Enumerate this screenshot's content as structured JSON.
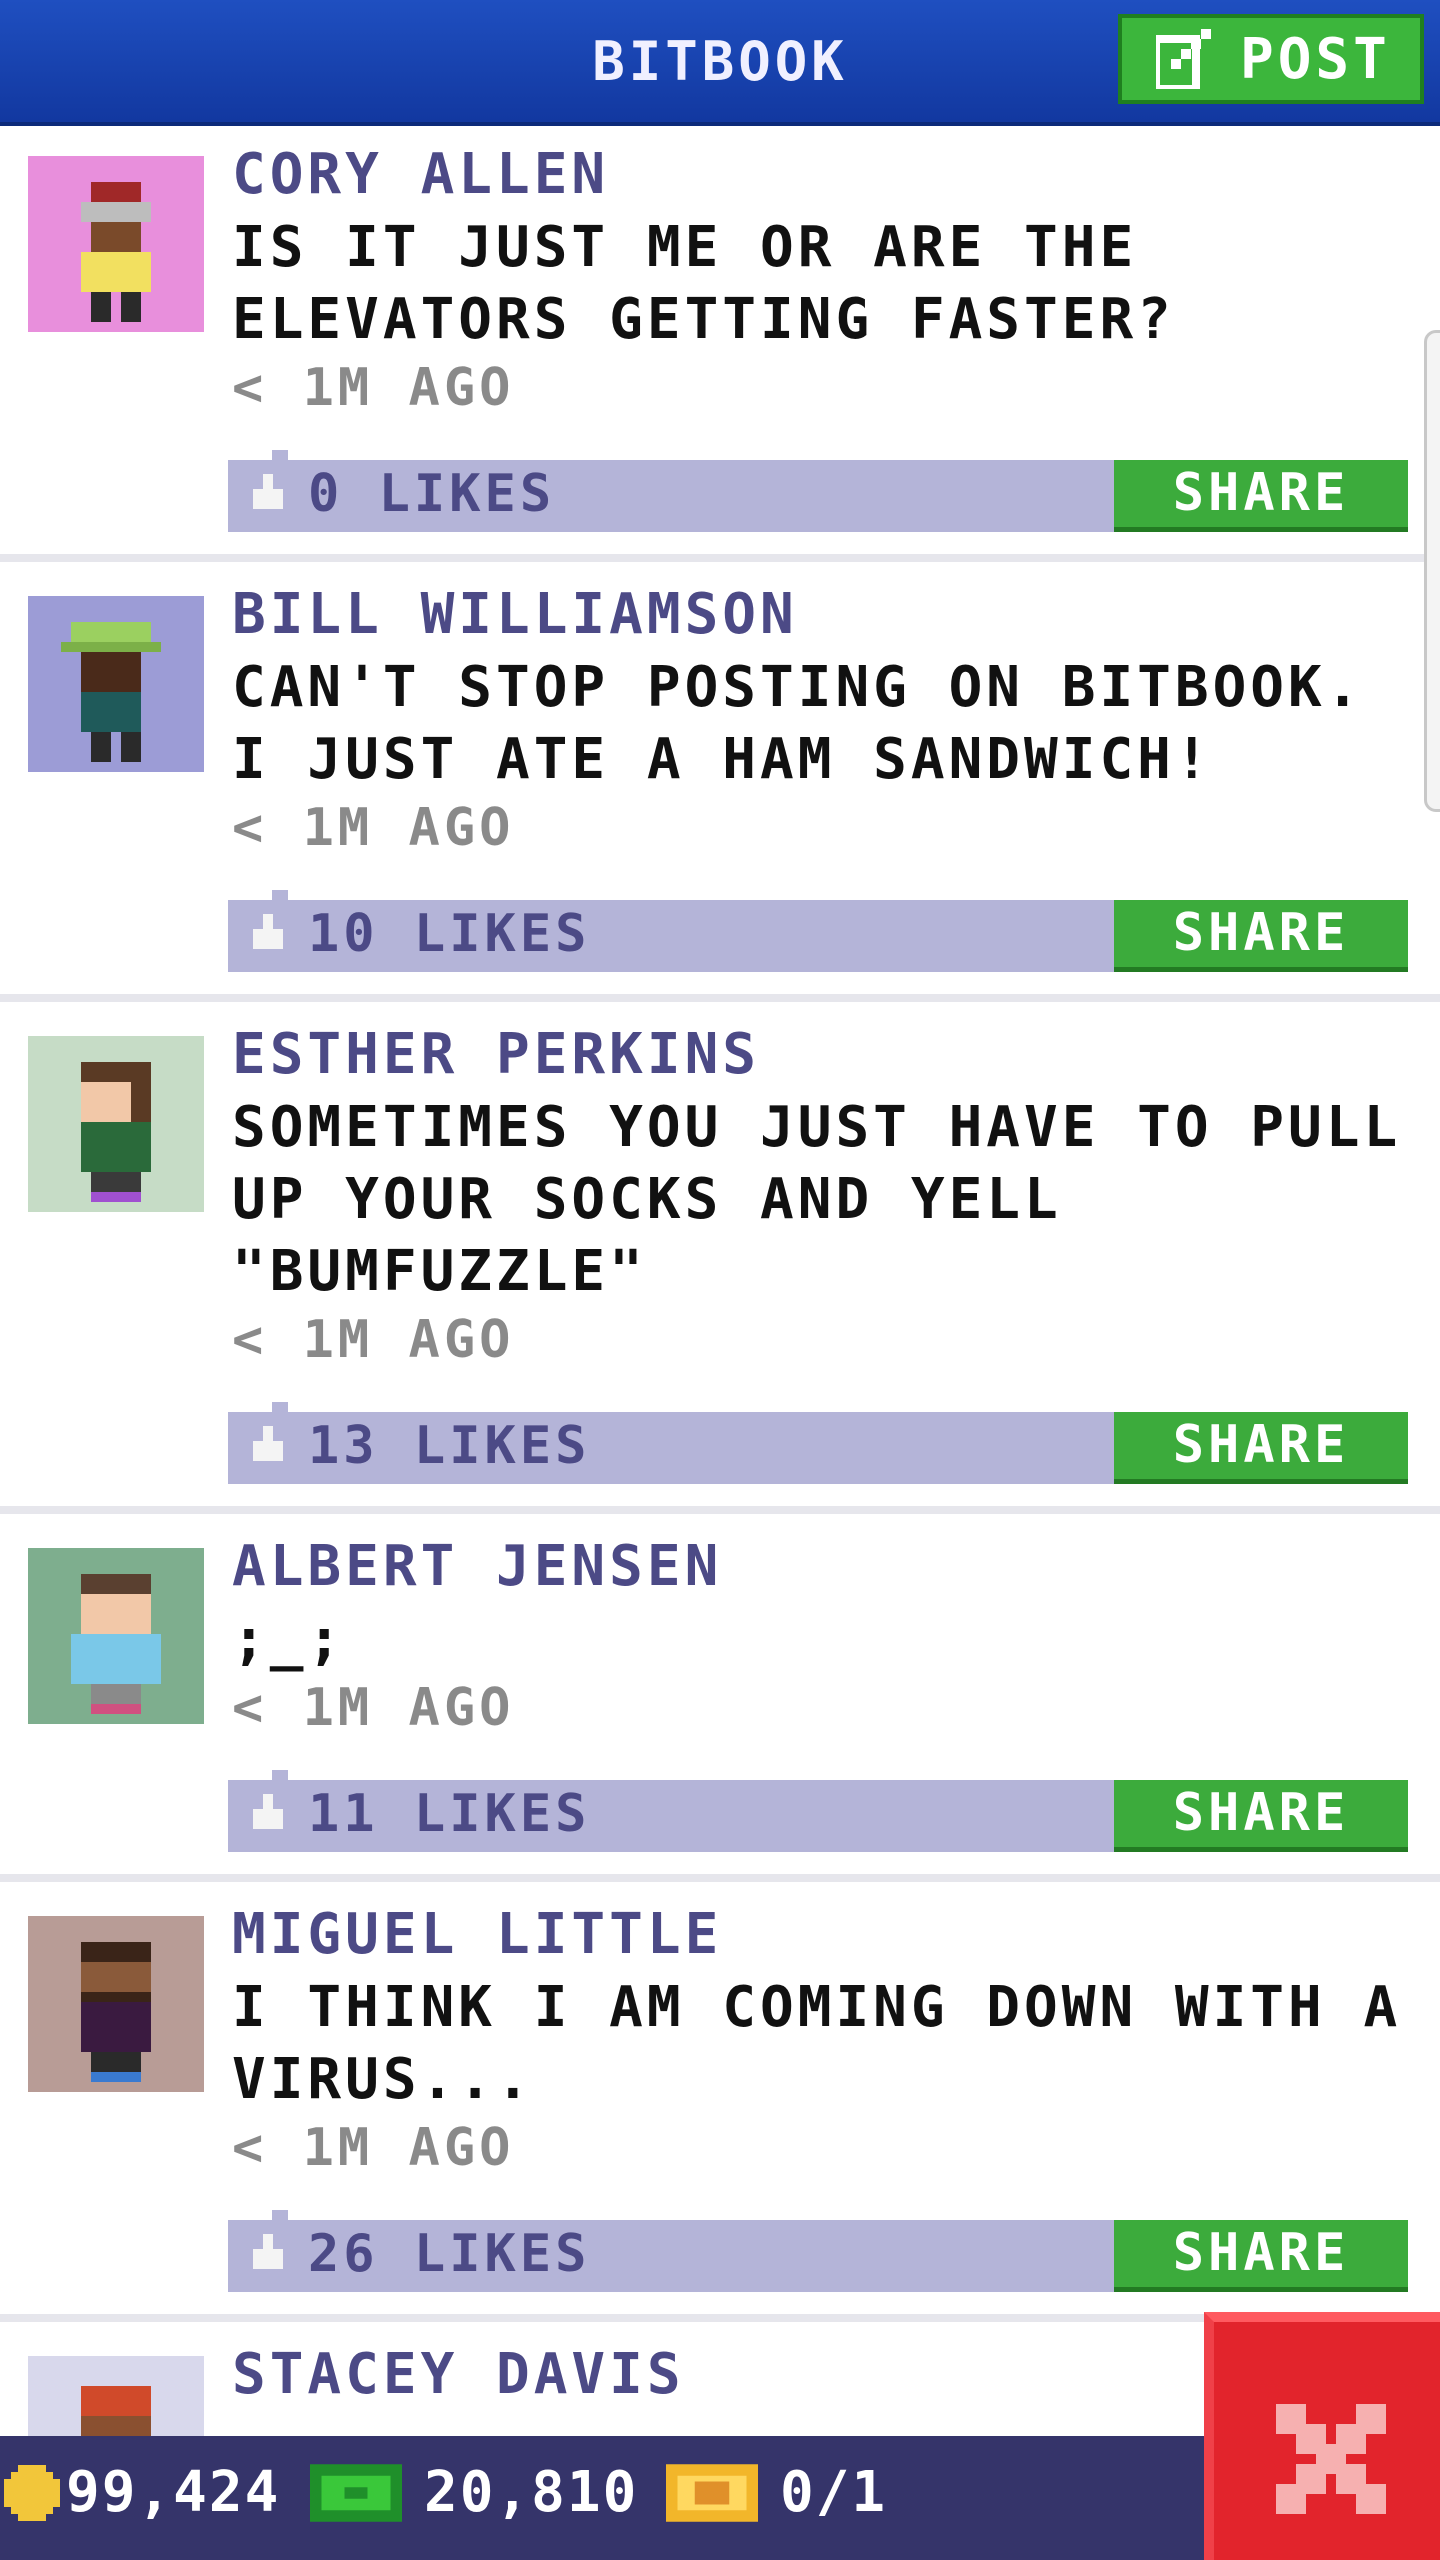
{
  "header": {
    "title": "BITBOOK",
    "post_label": "POST"
  },
  "posts": [
    {
      "author": "CORY ALLEN",
      "text": "IS IT JUST ME OR ARE THE ELEVATORS GETTING FASTER?",
      "time": "< 1M AGO",
      "likes": "0 LIKES",
      "share": "SHARE",
      "avatar_bg": "#e88fdc"
    },
    {
      "author": "BILL WILLIAMSON",
      "text": "CAN'T STOP POSTING ON BITBOOK. I JUST ATE A HAM SANDWICH!",
      "time": "< 1M AGO",
      "likes": "10 LIKES",
      "share": "SHARE",
      "avatar_bg": "#9c9cd6"
    },
    {
      "author": "ESTHER PERKINS",
      "text": "SOMETIMES YOU JUST HAVE TO PULL UP YOUR SOCKS AND YELL \"BUMFUZZLE\"",
      "time": "< 1M AGO",
      "likes": "13 LIKES",
      "share": "SHARE",
      "avatar_bg": "#c6dcc6"
    },
    {
      "author": "ALBERT JENSEN",
      "text": ";_;",
      "time": "< 1M AGO",
      "likes": "11 LIKES",
      "share": "SHARE",
      "avatar_bg": "#7eae8e"
    },
    {
      "author": "MIGUEL LITTLE",
      "text": "I THINK I AM COMING DOWN WITH A VIRUS...",
      "time": "< 1M AGO",
      "likes": "26 LIKES",
      "share": "SHARE",
      "avatar_bg": "#b89c96"
    },
    {
      "author": "STACEY DAVIS",
      "avatar_bg": "#d8d8ec"
    }
  ],
  "status": {
    "coins": "99,424",
    "bux": "20,810",
    "tickets": "0/1"
  },
  "colors": {
    "header": "#1f4fc0",
    "accent_green": "#3cb63c",
    "like_bar": "#b4b4d8",
    "author_text": "#4c4a86",
    "status_bar": "#35346a",
    "close_red": "#e2242c"
  },
  "icons": {
    "post": "edit-icon",
    "like": "thumbs-up-icon",
    "coin": "coin-icon",
    "bux": "bux-icon",
    "ticket": "ticket-icon",
    "close": "close-icon"
  }
}
